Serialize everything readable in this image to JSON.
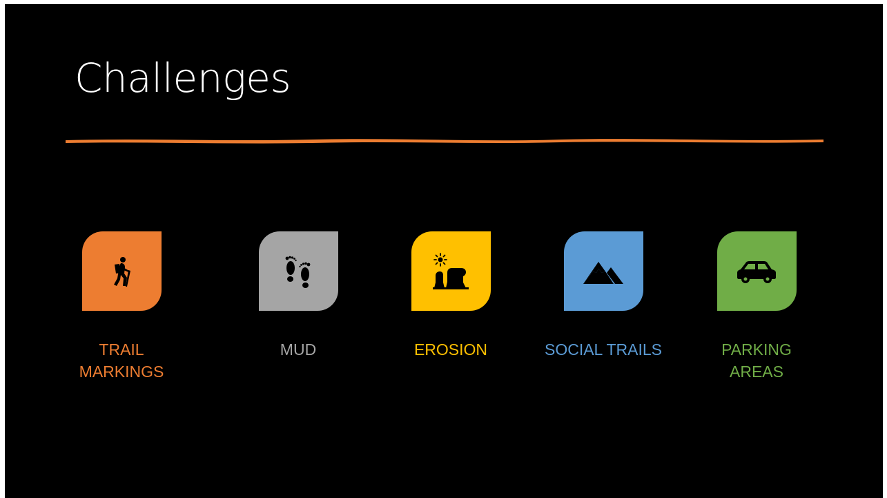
{
  "slide": {
    "title": "Challenges",
    "accent_color": "#ED7D31",
    "items": [
      {
        "label_line1": "TRAIL",
        "label_line2": "MARKINGS",
        "icon": "hiker-icon",
        "color": "#ED7D31"
      },
      {
        "label_line1": "MUD",
        "label_line2": "",
        "icon": "footprints-icon",
        "color": "#A5A5A5"
      },
      {
        "label_line1": "EROSION",
        "label_line2": "",
        "icon": "mesa-sun-icon",
        "color": "#FFC000"
      },
      {
        "label_line1": "SOCIAL TRAILS",
        "label_line2": "",
        "icon": "mountain-icon",
        "color": "#5B9BD5"
      },
      {
        "label_line1": "PARKING",
        "label_line2": "AREAS",
        "icon": "car-icon",
        "color": "#70AD47"
      }
    ]
  }
}
